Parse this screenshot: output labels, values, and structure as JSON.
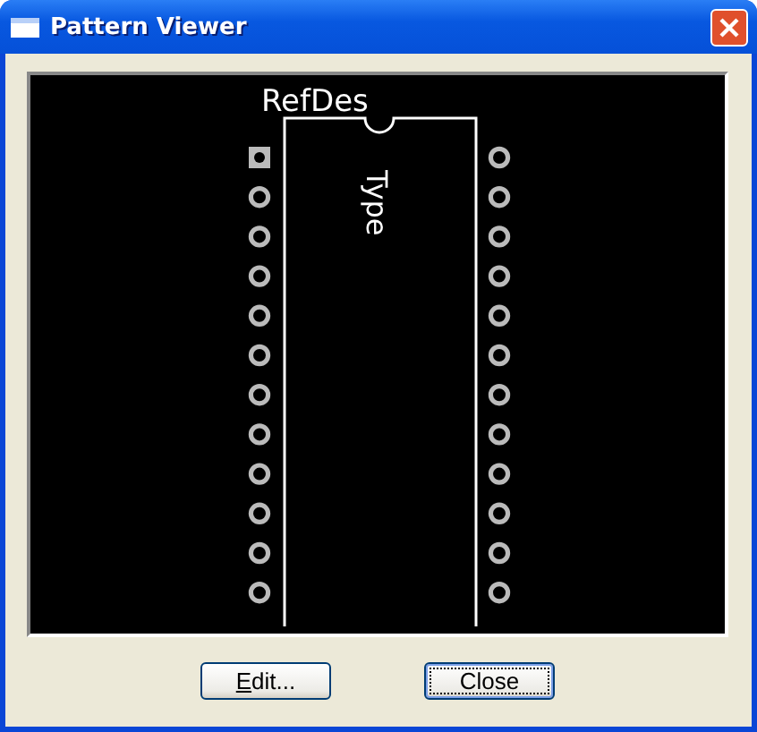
{
  "window": {
    "title": "Pattern Viewer"
  },
  "pattern": {
    "refdes": "RefDes",
    "type": "Type",
    "left_pins": [
      {
        "kind": "square"
      },
      {
        "kind": "round"
      },
      {
        "kind": "round"
      },
      {
        "kind": "round"
      },
      {
        "kind": "round"
      },
      {
        "kind": "round"
      },
      {
        "kind": "round"
      },
      {
        "kind": "round"
      },
      {
        "kind": "round"
      },
      {
        "kind": "round"
      },
      {
        "kind": "round"
      },
      {
        "kind": "round"
      }
    ],
    "right_pins": [
      {
        "kind": "round"
      },
      {
        "kind": "round"
      },
      {
        "kind": "round"
      },
      {
        "kind": "round"
      },
      {
        "kind": "round"
      },
      {
        "kind": "round"
      },
      {
        "kind": "round"
      },
      {
        "kind": "round"
      },
      {
        "kind": "round"
      },
      {
        "kind": "round"
      },
      {
        "kind": "round"
      },
      {
        "kind": "round"
      }
    ]
  },
  "buttons": [
    {
      "label": "Edit...",
      "mnemonic": true,
      "default": false
    },
    {
      "label": "Close",
      "mnemonic": false,
      "default": true
    }
  ]
}
